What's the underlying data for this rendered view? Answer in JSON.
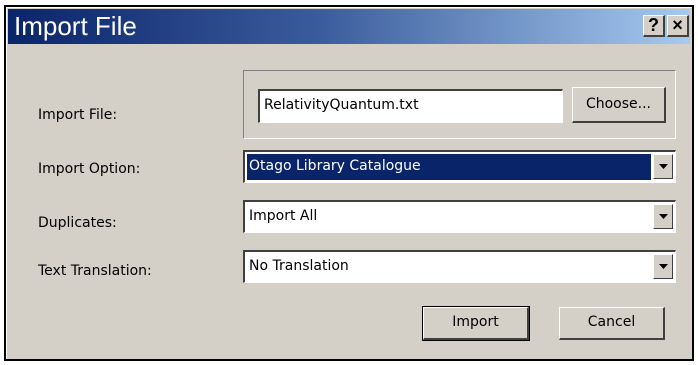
{
  "window": {
    "title": "Import File",
    "help_label": "?",
    "close_label": "×"
  },
  "form": {
    "import_file_label": "Import File:",
    "import_file_value": "RelativityQuantum.txt",
    "choose_label": "Choose...",
    "import_option_label": "Import Option:",
    "import_option_value": "Otago Library Catalogue",
    "duplicates_label": "Duplicates:",
    "duplicates_value": "Import All",
    "text_translation_label": "Text Translation:",
    "text_translation_value": "No Translation"
  },
  "buttons": {
    "import_label": "Import",
    "cancel_label": "Cancel"
  },
  "icons": {
    "help": "help-icon",
    "close": "close-icon",
    "dropdown": "chevron-down-icon"
  },
  "colors": {
    "title_start": "#0a246a",
    "title_end": "#a6caf0",
    "selection": "#0a246a",
    "face": "#d4d0c8"
  }
}
